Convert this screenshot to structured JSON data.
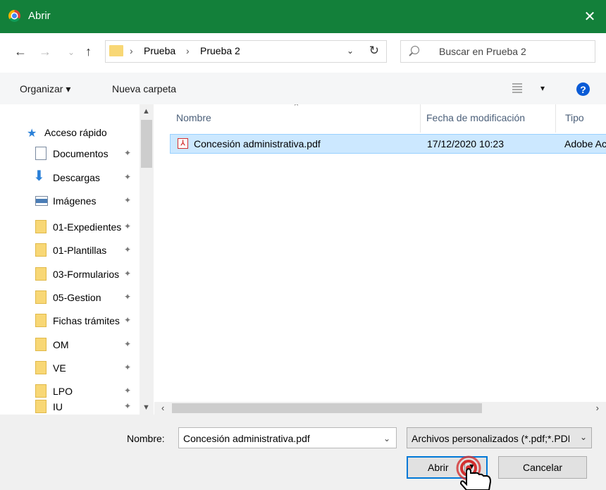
{
  "window": {
    "title": "Abrir",
    "close_glyph": "✕"
  },
  "nav": {
    "back": "←",
    "forward": "→",
    "recent": "⌄",
    "up": "↑"
  },
  "address": {
    "path": [
      "Prueba",
      "Prueba 2"
    ],
    "separator": "›",
    "dropdown": "⌄",
    "refresh": "↻"
  },
  "search": {
    "placeholder": "Buscar en Prueba 2"
  },
  "toolbar": {
    "organize": "Organizar ▾",
    "new_folder": "Nueva carpeta",
    "view_arrow": "▾",
    "help": "?"
  },
  "sidebar": {
    "quick_access": "Acceso rápido",
    "items": [
      {
        "label": "Documentos",
        "icon": "document-icon"
      },
      {
        "label": "Descargas",
        "icon": "download-icon"
      },
      {
        "label": "Imágenes",
        "icon": "pictures-icon"
      },
      {
        "label": "01-Expedientes",
        "icon": "folder-icon"
      },
      {
        "label": "01-Plantillas",
        "icon": "folder-icon"
      },
      {
        "label": "03-Formularios",
        "icon": "folder-icon"
      },
      {
        "label": "05-Gestion",
        "icon": "folder-icon"
      },
      {
        "label": "Fichas trámites",
        "icon": "folder-icon"
      },
      {
        "label": "OM",
        "icon": "folder-icon"
      },
      {
        "label": "VE",
        "icon": "folder-icon"
      },
      {
        "label": "LPO",
        "icon": "folder-icon"
      },
      {
        "label": "IU",
        "icon": "folder-icon"
      }
    ],
    "pin_glyph": "✦"
  },
  "columns": {
    "name": "Nombre",
    "modified": "Fecha de modificación",
    "type": "Tipo"
  },
  "files": [
    {
      "name": "Concesión administrativa.pdf",
      "modified": "17/12/2020 10:23",
      "type": "Adobe Acrobat Document"
    }
  ],
  "footer": {
    "name_label": "Nombre:",
    "name_value": "Concesión administrativa.pdf",
    "filter": "Archivos personalizados (*.pdf;*.PDF)",
    "open": "Abrir",
    "cancel": "Cancelar"
  },
  "colors": {
    "titlebar": "#13803a",
    "selection": "#cce8ff",
    "accent": "#0078d7",
    "cursor_ring": "#d32f2f"
  }
}
